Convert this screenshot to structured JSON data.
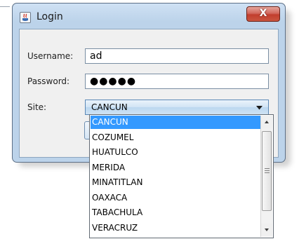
{
  "window": {
    "title": "Login",
    "close_label": "X"
  },
  "form": {
    "username_label": "Username:",
    "username_value": "ad",
    "password_label": "Password:",
    "password_masked": "●●●●●",
    "site_label": "Site:",
    "site_selected": "CANCUN"
  },
  "dropdown": {
    "options": [
      "CANCUN",
      "COZUMEL",
      "HUATULCO",
      "MERIDA",
      "MINATITLAN",
      "OAXACA",
      "TABACHULA",
      "VERACRUZ"
    ],
    "selected_index": 0
  },
  "colors": {
    "selection": "#3399ff",
    "close_button": "#c9553f"
  }
}
